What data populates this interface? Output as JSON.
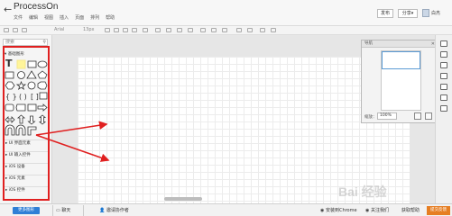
{
  "titlebar": {
    "back_icon": "back-arrow-icon",
    "app_title": "ProcessOn",
    "menus": [
      "文件",
      "编辑",
      "视图",
      "插入",
      "页面",
      "排列",
      "帮助"
    ],
    "publish": "发布",
    "share": "分享▾",
    "username": "白杰"
  },
  "toolbar": {
    "font": "Arial",
    "font_size": "13px"
  },
  "sidebar": {
    "search_placeholder": "搜索",
    "basic_shapes": "基础图形",
    "categories": [
      "UI 界面元素",
      "UI 输入控件",
      "iOS 设备",
      "iOS 元素",
      "iOS 控件"
    ]
  },
  "navigator": {
    "title": "导航",
    "close": "✕",
    "zoom_label": "缩放：",
    "zoom_value": "100%"
  },
  "bottombar": {
    "more_shapes": "更多图形",
    "chat": "聊天",
    "invite": "邀请协作者",
    "chrome": "安装到Chrome",
    "follow": "关注我们",
    "help": "获取帮助",
    "feedback": "提交反馈"
  },
  "colors": {
    "annotation_red": "#e02020",
    "primary_blue": "#2f7fd6",
    "feedback_orange": "#e67e22"
  },
  "watermark": "Bai 经验"
}
